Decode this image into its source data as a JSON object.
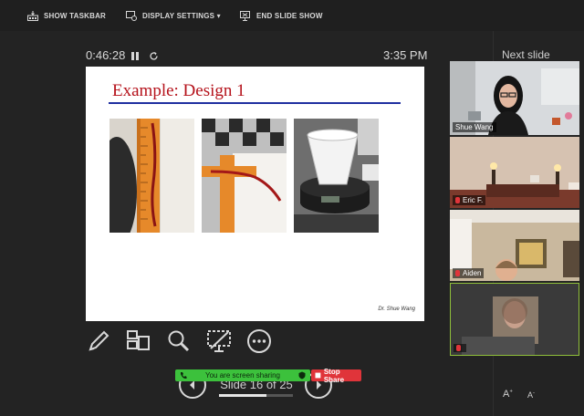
{
  "toolbar": {
    "show_taskbar": "SHOW TASKBAR",
    "display_settings": "DISPLAY SETTINGS ▾",
    "end_slide_show": "END SLIDE SHOW"
  },
  "presenter": {
    "timer": "0:46:28",
    "clock": "3:35 PM",
    "next_slide_label": "Next slide",
    "slide_counter": "Slide 16 of 25",
    "progress": 0.64
  },
  "slide": {
    "title": "Example: Design 1",
    "credit": "Dr. Shue Wang"
  },
  "share": {
    "status": "You are screen sharing",
    "stop_label": "Stop Share"
  },
  "font_buttons": {
    "increase": "A",
    "decrease": "A"
  },
  "participants": [
    {
      "name": "Shue Wang"
    },
    {
      "name": "Eric F."
    },
    {
      "name": "Aiden"
    },
    {
      "name": ""
    }
  ],
  "colors": {
    "title_red": "#b5121b",
    "rule_blue": "#1f2fa0",
    "share_green": "#3cc13c",
    "stop_red": "#e0343a",
    "active_speaker_border": "#8fbf3a"
  }
}
